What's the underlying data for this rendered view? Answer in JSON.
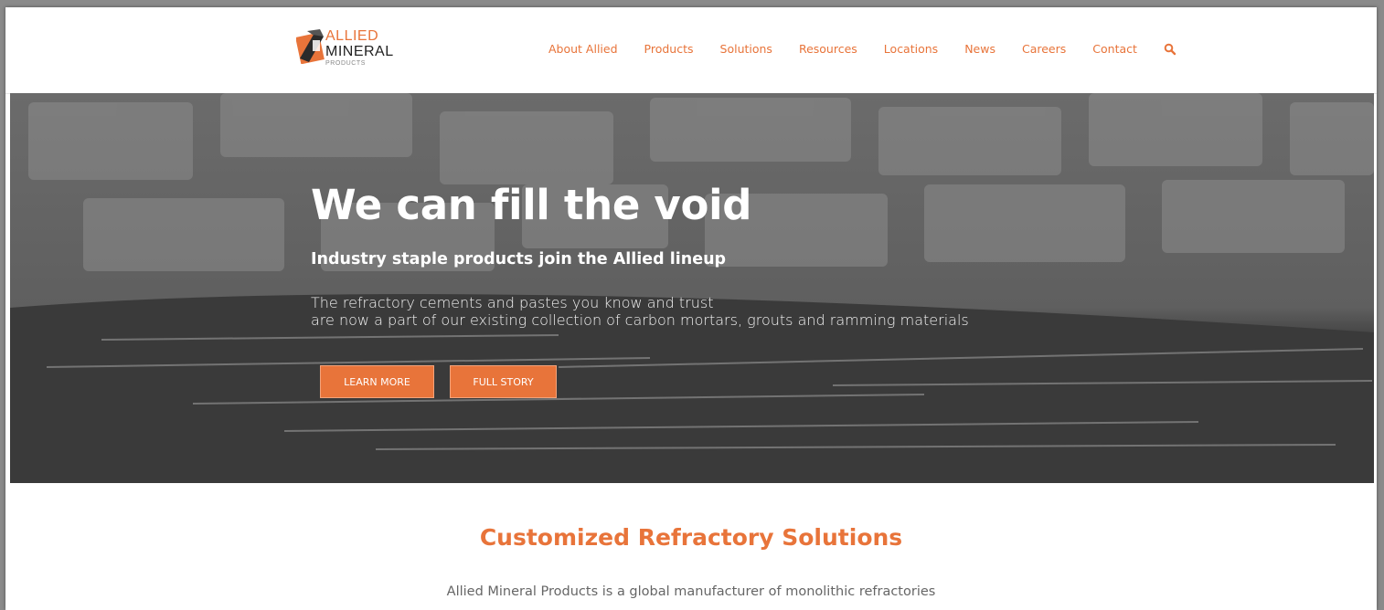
{
  "brand": {
    "name_line1": "ALLIED",
    "name_line2": "MINERAL",
    "name_line3": "PRODUCTS",
    "accent_color": "#e8743a"
  },
  "nav": {
    "items": [
      "About Allied",
      "Products",
      "Solutions",
      "Resources",
      "Locations",
      "News",
      "Careers",
      "Contact"
    ],
    "search_icon": "search-icon"
  },
  "hero": {
    "title": "We can fill the void",
    "subtitle": "Industry staple products join the Allied lineup",
    "text_line1": "The refractory cements and pastes you know and trust",
    "text_line2": "are now a part of our existing collection of carbon mortars, grouts and ramming materials",
    "button_learn": "LEARN MORE",
    "button_story": "FULL STORY"
  },
  "section": {
    "title": "Customized Refractory Solutions",
    "text": "Allied Mineral Products is a global manufacturer of monolithic refractories"
  }
}
